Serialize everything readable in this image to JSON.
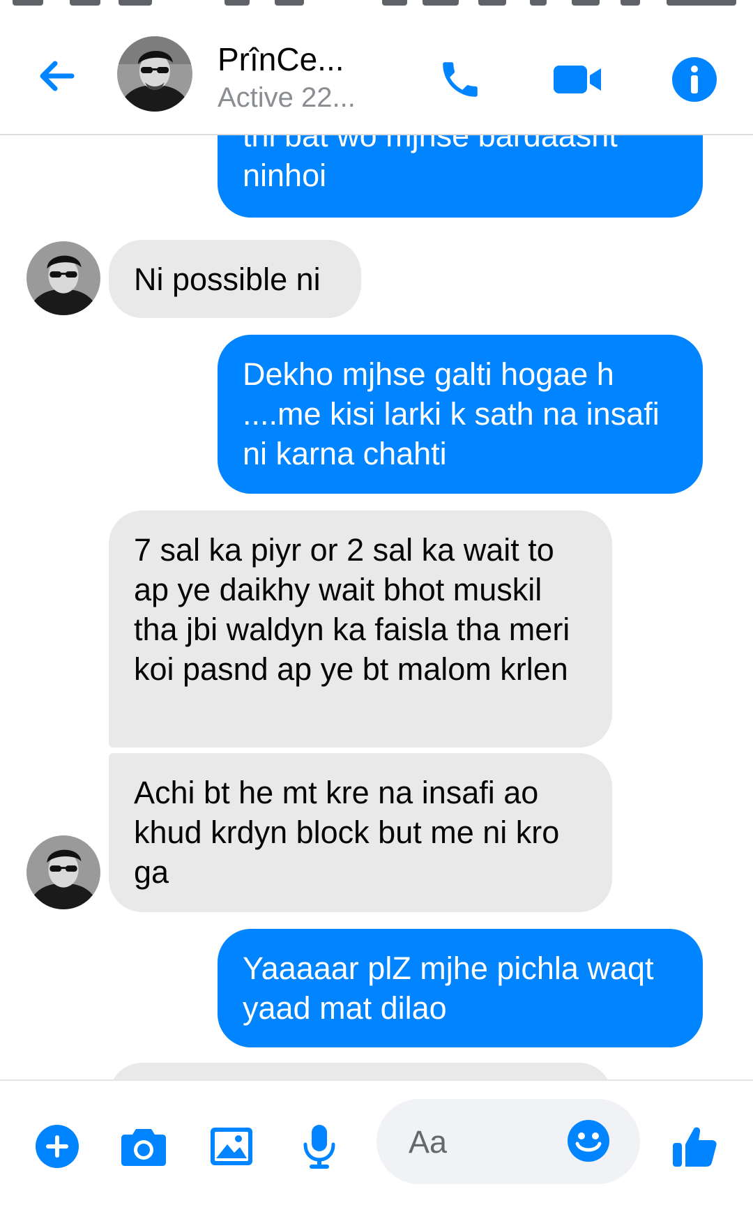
{
  "theme": {
    "accent": "#0084ff",
    "incoming_bubble": "#e9e9e9",
    "muted_text": "#8a8d91"
  },
  "header": {
    "contact_name": "PrînCe...",
    "contact_status": "Active 22...",
    "icons": [
      "back-arrow-icon",
      "phone-icon",
      "video-camera-icon",
      "info-icon"
    ]
  },
  "messages": [
    {
      "direction": "outgoing",
      "text": "thi bat wo mjhse bardaasht ninhoi"
    },
    {
      "direction": "incoming",
      "text": "Ni possible ni"
    },
    {
      "direction": "outgoing",
      "text": "Dekho mjhse galti hogae h ....me kisi larki k sath na insafi ni karna chahti"
    },
    {
      "direction": "incoming",
      "text": "7 sal ka piyr or 2 sal ka wait to ap ye daikhy wait bhot muskil tha jbi waldyn ka faisla tha meri koi pasnd ap ye bt malom krlen"
    },
    {
      "direction": "incoming",
      "text": "Achi bt he mt kre na insafi ao khud krdyn block but me ni kro ga"
    },
    {
      "direction": "outgoing",
      "text": "Yaaaaar plZ mjhe pichla waqt yaad mat dilao"
    }
  ],
  "composer": {
    "placeholder": "Aa",
    "icons": [
      "plus-icon",
      "camera-icon",
      "gallery-icon",
      "microphone-icon",
      "emoji-icon",
      "thumbs-up-icon"
    ]
  }
}
